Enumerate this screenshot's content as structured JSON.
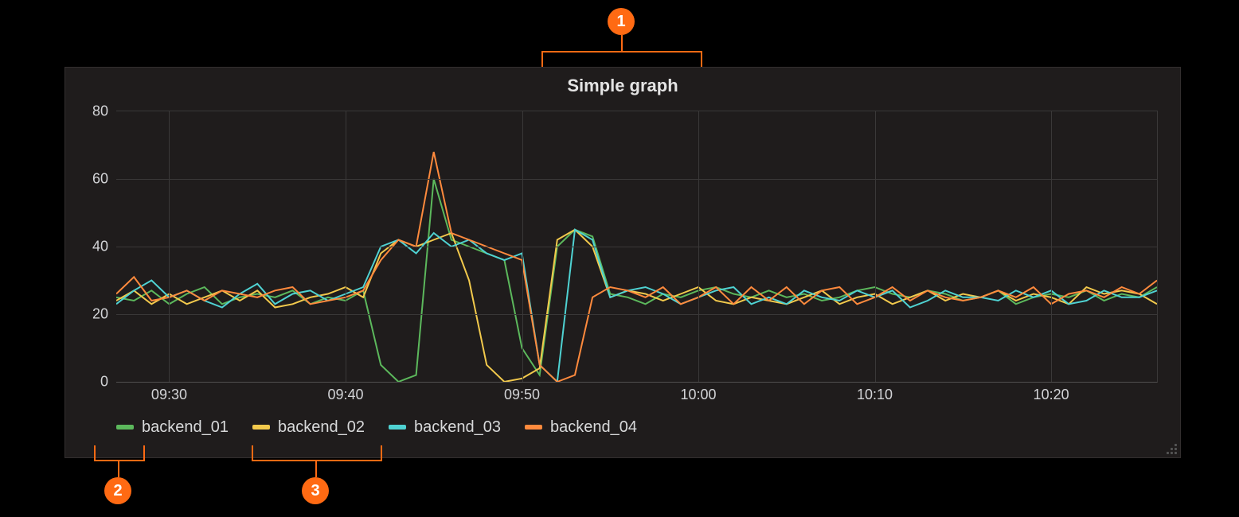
{
  "annotations": {
    "n1": "1",
    "n2": "2",
    "n3": "3"
  },
  "colors": {
    "accent": "#ff6a13",
    "backend_01": "#5cb85c",
    "backend_02": "#f2c94c",
    "backend_03": "#4fd2d2",
    "backend_04": "#ff8a3d"
  },
  "chart_data": {
    "type": "line",
    "title": "Simple graph",
    "xlabel": "",
    "ylabel": "",
    "ylim": [
      0,
      80
    ],
    "x_ticks": [
      "09:30",
      "09:40",
      "09:50",
      "10:00",
      "10:10",
      "10:20"
    ],
    "y_ticks": [
      0,
      20,
      40,
      60,
      80
    ],
    "legend": [
      "backend_01",
      "backend_02",
      "backend_03",
      "backend_04"
    ],
    "x": [
      "09:27",
      "09:28",
      "09:29",
      "09:30",
      "09:31",
      "09:32",
      "09:33",
      "09:34",
      "09:35",
      "09:36",
      "09:37",
      "09:38",
      "09:39",
      "09:40",
      "09:41",
      "09:42",
      "09:43",
      "09:44",
      "09:45",
      "09:46",
      "09:47",
      "09:48",
      "09:49",
      "09:50",
      "09:51",
      "09:52",
      "09:53",
      "09:54",
      "09:55",
      "09:56",
      "09:57",
      "09:58",
      "09:59",
      "10:00",
      "10:01",
      "10:02",
      "10:03",
      "10:04",
      "10:05",
      "10:06",
      "10:07",
      "10:08",
      "10:09",
      "10:10",
      "10:11",
      "10:12",
      "10:13",
      "10:14",
      "10:15",
      "10:16",
      "10:17",
      "10:18",
      "10:19",
      "10:20",
      "10:21",
      "10:22",
      "10:23",
      "10:24",
      "10:25",
      "10:26"
    ],
    "series": [
      {
        "name": "backend_01",
        "color": "#5cb85c",
        "values": [
          25,
          24,
          27,
          23,
          26,
          28,
          23,
          25,
          26,
          25,
          27,
          23,
          25,
          24,
          27,
          5,
          0,
          2,
          60,
          42,
          40,
          38,
          36,
          10,
          2,
          40,
          45,
          43,
          26,
          25,
          23,
          26,
          25,
          27,
          28,
          26,
          25,
          27,
          25,
          26,
          24,
          25,
          27,
          28,
          26,
          25,
          27,
          26,
          24,
          25,
          27,
          23,
          25,
          26,
          25,
          27,
          24,
          26,
          25,
          28
        ]
      },
      {
        "name": "backend_02",
        "color": "#f2c94c",
        "values": [
          24,
          27,
          23,
          26,
          23,
          25,
          27,
          24,
          27,
          22,
          23,
          25,
          26,
          28,
          25,
          38,
          42,
          40,
          42,
          44,
          30,
          5,
          0,
          1,
          4,
          42,
          45,
          40,
          25,
          27,
          26,
          24,
          26,
          28,
          24,
          23,
          25,
          24,
          23,
          25,
          27,
          23,
          25,
          26,
          23,
          25,
          27,
          24,
          26,
          25,
          27,
          24,
          26,
          25,
          23,
          28,
          26,
          27,
          26,
          23
        ]
      },
      {
        "name": "backend_03",
        "color": "#4fd2d2",
        "values": [
          23,
          27,
          30,
          25,
          27,
          24,
          22,
          26,
          29,
          23,
          26,
          27,
          24,
          26,
          28,
          40,
          42,
          38,
          44,
          40,
          42,
          38,
          36,
          38,
          5,
          0,
          45,
          42,
          25,
          27,
          28,
          26,
          23,
          25,
          27,
          28,
          23,
          25,
          23,
          27,
          25,
          24,
          27,
          25,
          27,
          22,
          24,
          27,
          25,
          25,
          24,
          27,
          25,
          27,
          23,
          24,
          27,
          25,
          25,
          27
        ]
      },
      {
        "name": "backend_04",
        "color": "#ff8a3d",
        "values": [
          26,
          31,
          24,
          25,
          27,
          24,
          27,
          26,
          25,
          27,
          28,
          23,
          24,
          25,
          27,
          36,
          42,
          40,
          68,
          44,
          42,
          40,
          38,
          36,
          5,
          0,
          2,
          25,
          28,
          27,
          25,
          28,
          23,
          25,
          28,
          23,
          28,
          24,
          28,
          23,
          27,
          28,
          23,
          25,
          28,
          24,
          27,
          25,
          24,
          25,
          27,
          25,
          28,
          23,
          26,
          27,
          25,
          28,
          26,
          30
        ]
      }
    ]
  }
}
